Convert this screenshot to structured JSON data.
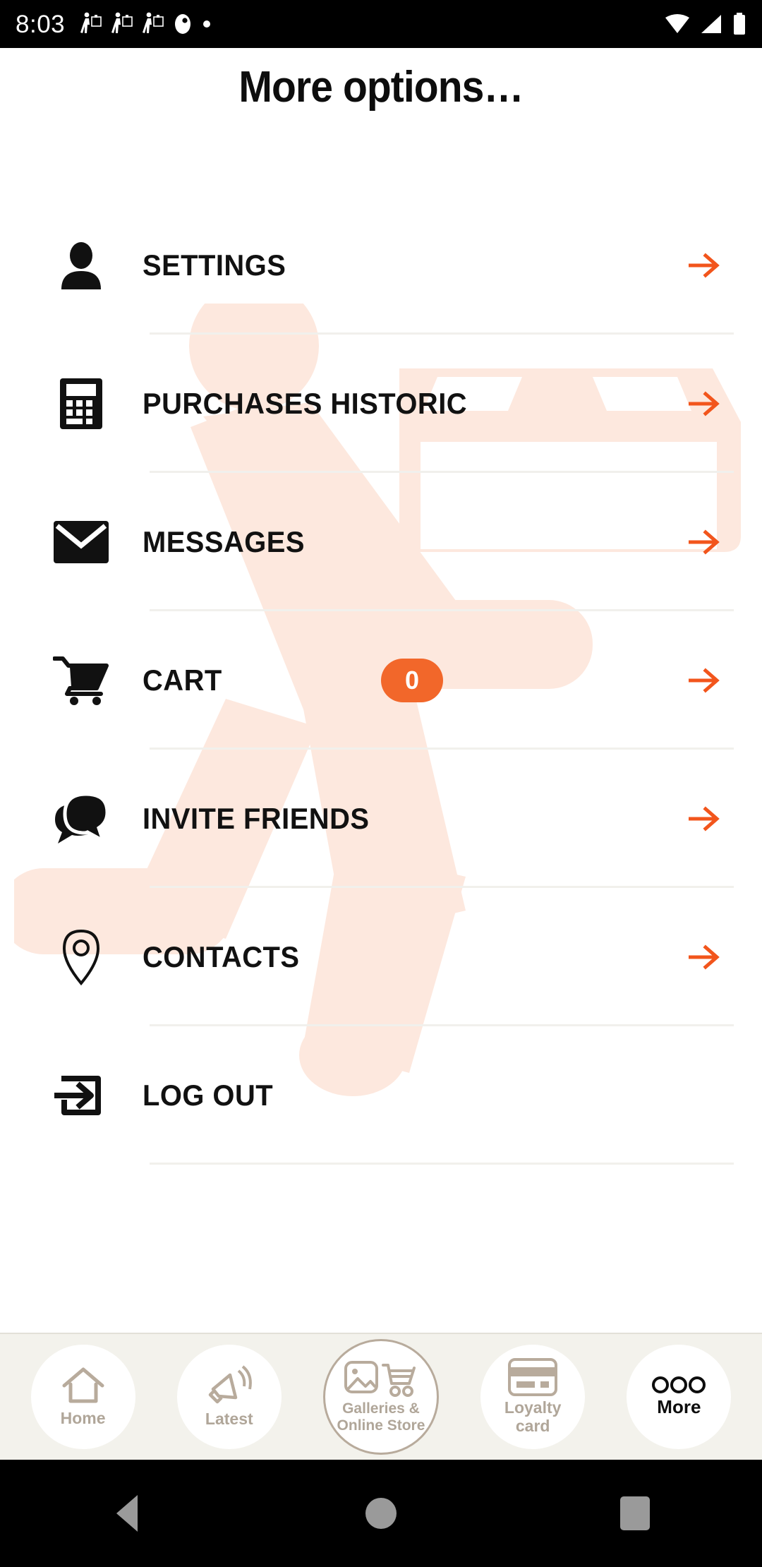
{
  "status_bar": {
    "time": "8:03",
    "left_icons": [
      "delivery-person-icon",
      "delivery-person-icon",
      "delivery-person-icon",
      "app-badge-icon",
      "dot-icon"
    ],
    "right_icons": [
      "wifi-icon",
      "signal-icon",
      "battery-icon"
    ]
  },
  "header": {
    "title": "More options…"
  },
  "menu": {
    "items": [
      {
        "label": "SETTINGS",
        "icon": "person-icon",
        "badge": null,
        "arrow": "arrow-right-icon"
      },
      {
        "label": "PURCHASES HISTORIC",
        "icon": "calculator-icon",
        "badge": null,
        "arrow": "arrow-right-icon"
      },
      {
        "label": "MESSAGES",
        "icon": "envelope-icon",
        "badge": null,
        "arrow": "arrow-right-icon"
      },
      {
        "label": "CART",
        "icon": "shopping-cart-icon",
        "badge": "0",
        "arrow": "arrow-right-icon"
      },
      {
        "label": "INVITE FRIENDS",
        "icon": "chat-bubbles-icon",
        "badge": null,
        "arrow": "arrow-right-icon"
      },
      {
        "label": "CONTACTS",
        "icon": "location-pin-icon",
        "badge": null,
        "arrow": "arrow-right-icon"
      },
      {
        "label": "LOG OUT",
        "icon": "logout-icon",
        "badge": null,
        "arrow": null
      }
    ]
  },
  "bottom_nav": {
    "items": [
      {
        "label": "Home",
        "icon": "home-icon",
        "active": false,
        "featured": false
      },
      {
        "label": "Latest",
        "icon": "megaphone-icon",
        "active": false,
        "featured": false
      },
      {
        "label": "Galleries &\nOnline Store",
        "icon": "gallery-cart-icon",
        "active": false,
        "featured": true
      },
      {
        "label": "Loyalty\ncard",
        "icon": "credit-card-icon",
        "active": false,
        "featured": false
      },
      {
        "label": "More",
        "icon": "three-circles-icon",
        "active": true,
        "featured": false
      }
    ]
  },
  "android_nav": {
    "back": "back-icon",
    "home": "home-circle-icon",
    "recents": "recents-icon"
  },
  "colors": {
    "accent_orange": "#F2551C",
    "badge_orange": "#F2672A",
    "watermark_peach": "#FDE8DE",
    "nav_background": "#F3F2EC",
    "nav_icon": "#B8AB9C",
    "divider": "#F1F0EC"
  },
  "watermark": {
    "description": "delivery-person-carrying-box-illustration"
  }
}
